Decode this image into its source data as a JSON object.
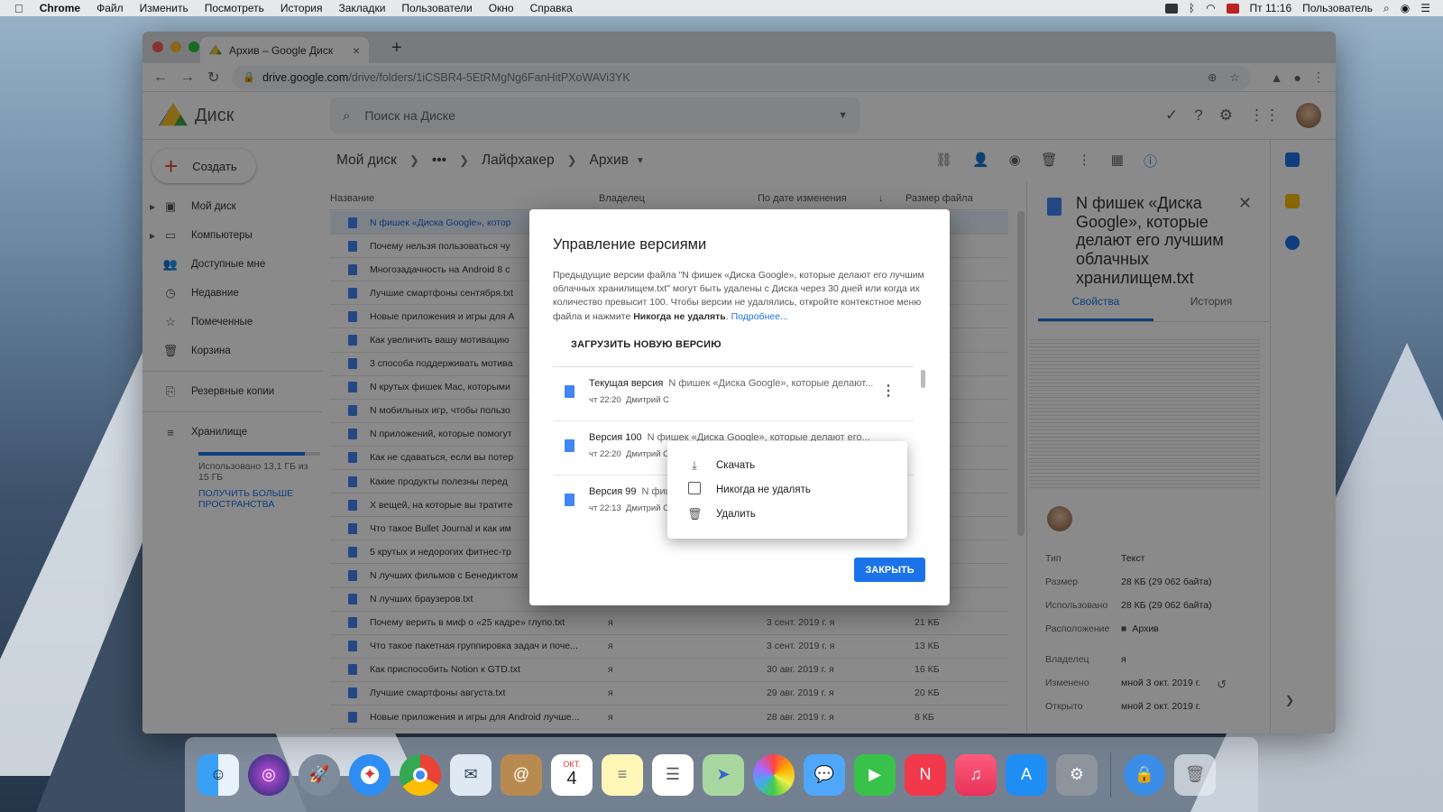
{
  "menubar": {
    "app": "Chrome",
    "items": [
      "Файл",
      "Изменить",
      "Посмотреть",
      "История",
      "Закладки",
      "Пользователи",
      "Окно",
      "Справка"
    ],
    "clock": "Пт 11:16",
    "user": "Пользователь"
  },
  "browser": {
    "tab_title": "Архив – Google Диск",
    "url_host": "drive.google.com",
    "url_path": "/drive/folders/1iCSBR4-5EtRMgNg6FanHitPXoWAVi3YK"
  },
  "drive": {
    "logo_text": "Диск",
    "search_placeholder": "Поиск на Диске",
    "new_button": "Создать",
    "nav": [
      {
        "label": "Мой диск",
        "icon": "my-drive-icon"
      },
      {
        "label": "Компьютеры",
        "icon": "computers-icon"
      },
      {
        "label": "Доступные мне",
        "icon": "shared-icon"
      },
      {
        "label": "Недавние",
        "icon": "clock-icon"
      },
      {
        "label": "Помеченные",
        "icon": "star-icon"
      },
      {
        "label": "Корзина",
        "icon": "trash-icon"
      },
      {
        "label": "Резервные копии",
        "icon": "backup-icon"
      },
      {
        "label": "Хранилище",
        "icon": "storage-icon"
      }
    ],
    "storage": {
      "used_text": "Использовано 13,1 ГБ из 15 ГБ",
      "used_fraction": 0.873,
      "upgrade_link": "ПОЛУЧИТЬ БОЛЬШЕ ПРОСТРАНСТВА"
    },
    "breadcrumb": [
      "Мой диск",
      "•••",
      "Лайфхакер",
      "Архив"
    ],
    "columns": {
      "name": "Название",
      "owner": "Владелец",
      "modified": "По дате изменения",
      "size": "Размер файла"
    },
    "files": [
      {
        "name": "N фишек «Диска Google», котор",
        "owner": "",
        "date": "",
        "size": ""
      },
      {
        "name": "Почему нельзя пользоваться чу",
        "owner": "",
        "date": "",
        "size": ""
      },
      {
        "name": "Многозадачность на Android 8 с",
        "owner": "",
        "date": "",
        "size": ""
      },
      {
        "name": "Лучшие смартфоны сентября.txt",
        "owner": "",
        "date": "",
        "size": ""
      },
      {
        "name": "Новые приложения и игры для A",
        "owner": "",
        "date": "",
        "size": ""
      },
      {
        "name": "Как увеличить вашу мотивацию",
        "owner": "",
        "date": "",
        "size": ""
      },
      {
        "name": "3 способа поддерживать мотива",
        "owner": "",
        "date": "",
        "size": ""
      },
      {
        "name": "N крутых фишек Mac, которыми",
        "owner": "",
        "date": "",
        "size": ""
      },
      {
        "name": "N мобильных игр, чтобы пользо",
        "owner": "",
        "date": "",
        "size": ""
      },
      {
        "name": "N приложений, которые помогут",
        "owner": "",
        "date": "",
        "size": ""
      },
      {
        "name": "Как не сдаваться, если вы потер",
        "owner": "",
        "date": "",
        "size": ""
      },
      {
        "name": "Какие продукты полезны перед",
        "owner": "",
        "date": "",
        "size": ""
      },
      {
        "name": "X вещей, на которые вы тратите",
        "owner": "",
        "date": "",
        "size": ""
      },
      {
        "name": "Что такое Bullet Journal и как им",
        "owner": "",
        "date": "",
        "size": ""
      },
      {
        "name": "5 крутых и недорогих фитнес-тр",
        "owner": "",
        "date": "",
        "size": ""
      },
      {
        "name": "N лучших фильмов с Бенедиктом",
        "owner": "",
        "date": "",
        "size": ""
      },
      {
        "name": "N лучших браузеров.txt",
        "owner": "",
        "date": "",
        "size": ""
      },
      {
        "name": "Почему верить в миф о «25 кадре» глупо.txt",
        "owner": "я",
        "date": "3 сент. 2019 г. я",
        "size": "21 КБ"
      },
      {
        "name": "Что такое пакетная группировка задач и поче...",
        "owner": "я",
        "date": "3 сент. 2019 г. я",
        "size": "13 КБ"
      },
      {
        "name": "Как приспособить Notion к GTD.txt",
        "owner": "я",
        "date": "30 авг. 2019 г. я",
        "size": "16 КБ"
      },
      {
        "name": "Лучшие смартфоны августа.txt",
        "owner": "я",
        "date": "29 авг. 2019 г. я",
        "size": "20 КБ"
      },
      {
        "name": "Новые приложения и игры для Android лучше...",
        "owner": "я",
        "date": "28 авг. 2019 г. я",
        "size": "8 КБ"
      }
    ],
    "details": {
      "title": "N фишек «Диска Google», которые делают его лучшим облачных хранилищем.txt",
      "tab_props": "Свойства",
      "tab_history": "История",
      "props": [
        {
          "k": "Тип",
          "v": "Текст"
        },
        {
          "k": "Размер",
          "v": "28 КБ (29 062 байта)"
        },
        {
          "k": "Использовано",
          "v": "28 КБ (29 062 байта)"
        },
        {
          "k": "Расположение",
          "v": "Архив"
        },
        {
          "k": "Владелец",
          "v": "я"
        },
        {
          "k": "Изменено",
          "v": "мной 3 окт. 2019 г."
        },
        {
          "k": "Открыто",
          "v": "мной 2 окт. 2019 г."
        }
      ]
    }
  },
  "dialog": {
    "title": "Управление версиями",
    "text_main": "Предыдущие версии файла \"N фишек «Диска Google», которые делают его лучшим облачных хранилищем.txt\" могут быть удалены с Диска через 30 дней или когда их количество превысит 100. Чтобы версии не удалялись, откройте контекстное меню файла и нажмите",
    "text_bold": "Никогда не удалять",
    "text_link": "Подробнее...",
    "upload_label": "ЗАГРУЗИТЬ НОВУЮ ВЕРСИЮ",
    "versions": [
      {
        "label": "Текущая версия",
        "file": "N фишек «Диска Google», которые делают...",
        "time": "чт 22:20",
        "author": "Дмитрий С"
      },
      {
        "label": "Версия 100",
        "file": "N фишек «Диска Google», которые делают его...",
        "time": "чт 22:20",
        "author": "Дмитрий С"
      },
      {
        "label": "Версия 99",
        "file": "N фиш",
        "time": "чт 22:13",
        "author": "Дмитрий С"
      }
    ],
    "close_button": "ЗАКРЫТЬ",
    "context_menu": [
      {
        "label": "Скачать",
        "icon": "download-icon"
      },
      {
        "label": "Никогда не удалять",
        "icon": "checkbox-icon"
      },
      {
        "label": "Удалить",
        "icon": "trash-icon"
      }
    ]
  },
  "dock": {
    "apps": [
      "finder-icon",
      "siri-icon",
      "launchpad-icon",
      "safari-icon",
      "chrome-icon",
      "mail-icon",
      "contacts-icon",
      "calendar-icon",
      "notes-icon",
      "reminders-icon",
      "maps-icon",
      "photos-icon",
      "messages-icon",
      "facetime-icon",
      "news-icon",
      "music-icon",
      "appstore-icon",
      "preferences-icon",
      "vpn-icon",
      "trash-icon"
    ],
    "calendar_month": "ОКТ.",
    "calendar_day": "4"
  }
}
